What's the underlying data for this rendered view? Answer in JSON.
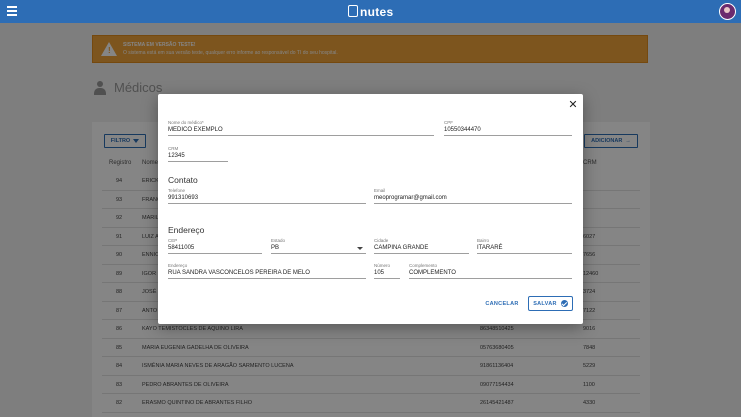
{
  "header": {
    "logo_text": "nutes"
  },
  "alert": {
    "title": "SISTEMA EM VERSÃO TESTE!",
    "message": "O sistema está em sua versão teste, qualquer erro informe ao responsável do TI do seu hospital."
  },
  "page": {
    "title": "Médicos"
  },
  "toolbar": {
    "filter_label": "FILTRO",
    "add_label": "ADICIONAR"
  },
  "table": {
    "columns": {
      "id": "Registro",
      "name": "Nome",
      "crm": "CRM"
    },
    "rows": [
      {
        "id": "94",
        "name": "ERICK",
        "tel": "",
        "crm": ""
      },
      {
        "id": "93",
        "name": "FRANC",
        "tel": "",
        "crm": ""
      },
      {
        "id": "92",
        "name": "MARIL",
        "tel": "",
        "crm": ""
      },
      {
        "id": "91",
        "name": "LUIZ A",
        "tel": "",
        "crm": "6027"
      },
      {
        "id": "90",
        "name": "ENNIO",
        "tel": "",
        "crm": "7656"
      },
      {
        "id": "89",
        "name": "IGOR",
        "tel": "",
        "crm": "12460"
      },
      {
        "id": "88",
        "name": "JOSÉ",
        "tel": "",
        "crm": "3724"
      },
      {
        "id": "87",
        "name": "ANTO",
        "tel": "",
        "crm": "7122"
      },
      {
        "id": "86",
        "name": "KAYO TEMISTOCLES DE AQUINO LIRA",
        "tel": "86348510425",
        "crm": "9016"
      },
      {
        "id": "85",
        "name": "MARIA EUGENIA GADELHA DE OLIVEIRA",
        "tel": "05763680405",
        "crm": "7848"
      },
      {
        "id": "84",
        "name": "ISMÊNIA MARIA NEVES DE ARAGÃO SARMENTO LUCENA",
        "tel": "91861136404",
        "crm": "5229"
      },
      {
        "id": "83",
        "name": "PEDRO ABRANTES DE OLIVEIRA",
        "tel": "09077154434",
        "crm": "1100"
      },
      {
        "id": "82",
        "name": "ERASMO QUINTINO DE ABRANTES FILHO",
        "tel": "26145421487",
        "crm": "4330"
      }
    ]
  },
  "modal": {
    "nome": {
      "label": "Nome do médico*",
      "value": "MEDICO EXEMPLO"
    },
    "cpf": {
      "label": "CPF",
      "value": "10550344470"
    },
    "crm": {
      "label": "CRM",
      "value": "12345"
    },
    "contato_title": "Contato",
    "telefone": {
      "label": "Telefone",
      "value": "991310693"
    },
    "email": {
      "label": "Email",
      "value": "meoprogramar@gmail.com"
    },
    "endereco_title": "Endereço",
    "cep": {
      "label": "CEP",
      "value": "58411005"
    },
    "estado": {
      "label": "Estado",
      "value": "PB"
    },
    "cidade": {
      "label": "Cidade",
      "value": "CAMPINA GRANDE"
    },
    "bairro": {
      "label": "Bairro",
      "value": "ITARARÉ"
    },
    "endereco": {
      "label": "Endereço",
      "value": "RUA SANDRA VASCONCELOS PEREIRA DE MELO"
    },
    "numero": {
      "label": "Número",
      "value": "105"
    },
    "complemento": {
      "label": "Complemento",
      "value": "COMPLEMENTO"
    },
    "cancel_label": "CANCELAR",
    "save_label": "SALVAR"
  },
  "colors": {
    "primary": "#2d6db5",
    "alert": "#f0a33a"
  },
  "icons": [
    "menu-icon",
    "avatar",
    "warning-icon",
    "doctor-icon",
    "filter-icon",
    "arrow-right-icon",
    "close-icon",
    "check-circle-icon",
    "dropdown-caret-icon"
  ]
}
